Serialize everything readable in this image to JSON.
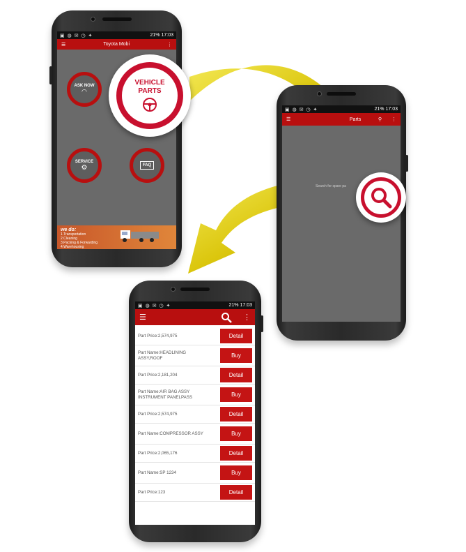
{
  "status": {
    "time": "17:03",
    "battery": "21%"
  },
  "phone1": {
    "title": "Toyota Mobi",
    "menu": {
      "ask_now": "ASK NOW",
      "service": "SERVICE",
      "faq": "FAQ"
    },
    "banner": {
      "heading": "we do:",
      "lines": [
        "1.Transportation",
        "2.Cleaning",
        "3.Packing & Forwarding",
        "4.Warehousing"
      ]
    }
  },
  "vehicle_parts": {
    "line1": "VEHICLE",
    "line2": "PARTS",
    "icon": "steering-wheel-icon"
  },
  "phone2": {
    "title": "Parts",
    "search_hint": "Search for spare pa"
  },
  "phone3": {
    "rows": [
      {
        "kind": "price",
        "text": "Part Price:2,574,975",
        "action": "Detail"
      },
      {
        "kind": "name",
        "text": "Part Name:HEADLINING ASSY,ROOF",
        "action": "Buy"
      },
      {
        "kind": "price",
        "text": "Part Price:2,181,204",
        "action": "Detail"
      },
      {
        "kind": "name",
        "text": "Part Name:AIR BAG ASSY INSTRUMENT PANELPASS",
        "action": "Buy"
      },
      {
        "kind": "price",
        "text": "Part Price:2,574,975",
        "action": "Detail"
      },
      {
        "kind": "name",
        "text": "Part Name:COMPRESSOR ASSY",
        "action": "Buy"
      },
      {
        "kind": "price",
        "text": "Part Price:2,065,176",
        "action": "Detail"
      },
      {
        "kind": "name",
        "text": "Part Name:SP 1234",
        "action": "Buy"
      },
      {
        "kind": "price",
        "text": "Part Price:123",
        "action": "Detail"
      }
    ]
  },
  "colors": {
    "brand_red": "#b80f0f",
    "accent_red": "#c8102e",
    "arrow_yellow": "#d6c200"
  }
}
